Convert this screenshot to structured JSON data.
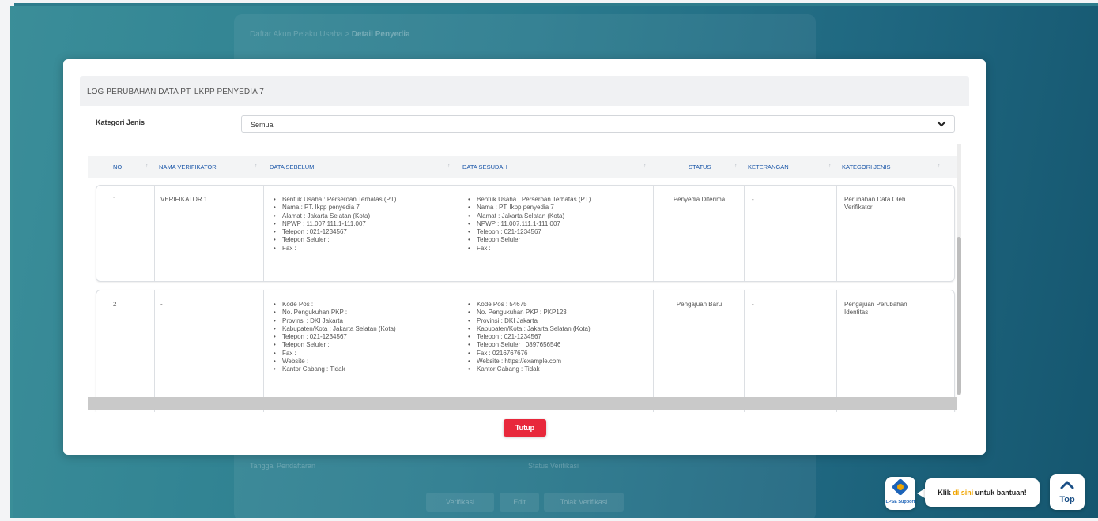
{
  "background": {
    "breadcrumb": [
      "Daftar Akun Pelaku Usaha",
      ">",
      "Detail Penyedia"
    ],
    "meta": [
      "Tanggal Pendaftaran",
      "Status Verifikasi"
    ],
    "buttons": [
      "Verifikasi",
      "Edit",
      "Tolak Verifikasi"
    ]
  },
  "modal": {
    "title": "LOG PERUBAHAN DATA PT. LKPP PENYEDIA 7",
    "kategori_label": "Kategori Jenis",
    "kategori_value": "Semua",
    "columns": [
      "NO",
      "NAMA VERIFIKATOR",
      "DATA SEBELUM",
      "DATA SESUDAH",
      "STATUS",
      "KETERANGAN",
      "KATEGORI JENIS"
    ],
    "rows": [
      {
        "no": "1",
        "verifikator": "VERIFIKATOR 1",
        "sebelum": [
          "Bentuk Usaha : Perseroan Terbatas (PT)",
          "Nama : PT. lkpp penyedia 7",
          "Alamat : Jakarta Selatan (Kota)",
          "NPWP : 11.007.111.1-111.007",
          "Telepon : 021-1234567",
          "Telepon Seluler :",
          "Fax :"
        ],
        "sesudah": [
          "Bentuk Usaha : Perseroan Terbatas (PT)",
          "Nama : PT. lkpp penyedia 7",
          "Alamat : Jakarta Selatan (Kota)",
          "NPWP : 11.007.111.1-111.007",
          "Telepon : 021-1234567",
          "Telepon Seluler :",
          "Fax :"
        ],
        "status": "Penyedia Diterima",
        "keterangan": "-",
        "kategori": "Perubahan Data Oleh Verifikator"
      },
      {
        "no": "2",
        "verifikator": "-",
        "sebelum": [
          "Kode Pos :",
          "No. Pengukuhan PKP :",
          "Provinsi : DKI Jakarta",
          "Kabupaten/Kota : Jakarta Selatan (Kota)",
          "Telepon : 021-1234567",
          "Telepon Seluler :",
          "Fax :",
          "Website :",
          "Kantor Cabang : Tidak"
        ],
        "sesudah": [
          "Kode Pos : 54675",
          "No. Pengukuhan PKP : PKP123",
          "Provinsi : DKI Jakarta",
          "Kabupaten/Kota : Jakarta Selatan (Kota)",
          "Telepon : 021-1234567",
          "Telepon Seluler : 0897656546",
          "Fax : 0216767676",
          "Website : https://example.com",
          "Kantor Cabang : Tidak"
        ],
        "status": "Pengajuan Baru",
        "keterangan": "-",
        "kategori": "Pengajuan Perubahan Identitas"
      }
    ],
    "close_label": "Tutup"
  },
  "support": {
    "caption": "LPSE Support",
    "help_prefix": "Klik ",
    "help_link": "di sini",
    "help_suffix": " untuk bantuan!",
    "top_label": "Top"
  },
  "colors": {
    "accent": "#1a56a8",
    "danger": "#e8283b",
    "support": "#f0a500"
  }
}
